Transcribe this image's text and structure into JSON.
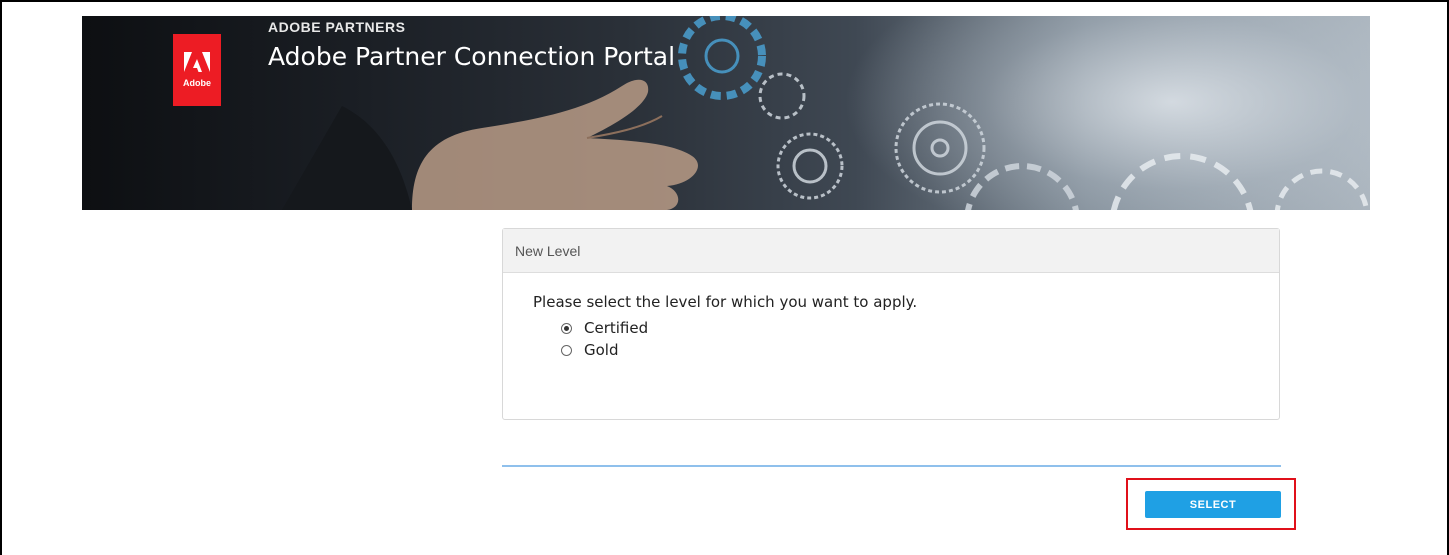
{
  "header": {
    "brand_small": "ADOBE PARTNERS",
    "title": "Adobe Partner Connection Portal",
    "logo_text": "Adobe",
    "logo_color": "#ed1c24"
  },
  "panel": {
    "heading": "New Level",
    "prompt": "Please select the level for which you want to apply.",
    "options": [
      {
        "label": "Certified",
        "selected": true
      },
      {
        "label": "Gold",
        "selected": false
      }
    ]
  },
  "footer": {
    "select_label": "SELECT",
    "button_color": "#1fa0e4",
    "highlight_color": "#e0101a"
  }
}
